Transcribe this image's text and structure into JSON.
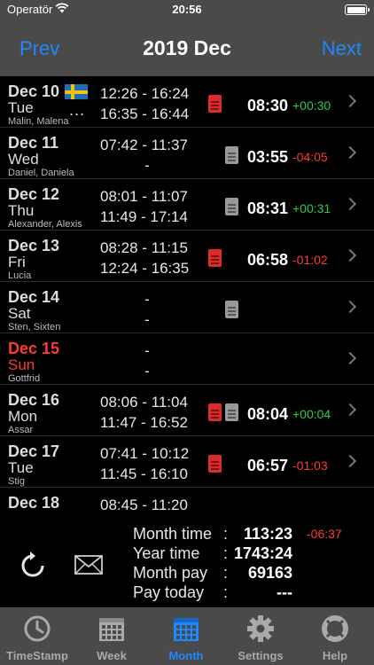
{
  "status": {
    "carrier": "Operatör",
    "time": "20:56"
  },
  "nav": {
    "prev": "Prev",
    "title": "2019 Dec",
    "next": "Next"
  },
  "days": [
    {
      "date": "Dec 10",
      "weekday": "Tue",
      "names": "Malin, Malena",
      "flag": "swedish-flag",
      "more": "...",
      "times": [
        "12:26 - 16:24",
        "16:35 - 16:44"
      ],
      "docs": [
        "red"
      ],
      "total": "08:30",
      "diff": "+00:30",
      "diff_sign": "pos"
    },
    {
      "date": "Dec 11",
      "weekday": "Wed",
      "names": "Daniel, Daniela",
      "times": [
        "07:42 - 11:37",
        "-"
      ],
      "docs": [
        "gray"
      ],
      "total": "03:55",
      "diff": "-04:05",
      "diff_sign": "neg"
    },
    {
      "date": "Dec 12",
      "weekday": "Thu",
      "names": "Alexander, Alexis",
      "times": [
        "08:01 - 11:07",
        "11:49 - 17:14"
      ],
      "docs": [
        "gray"
      ],
      "total": "08:31",
      "diff": "+00:31",
      "diff_sign": "pos"
    },
    {
      "date": "Dec 13",
      "weekday": "Fri",
      "names": "Lucia",
      "times": [
        "08:28 - 11:15",
        "12:24 - 16:35"
      ],
      "docs": [
        "red"
      ],
      "total": "06:58",
      "diff": "-01:02",
      "diff_sign": "neg"
    },
    {
      "date": "Dec 14",
      "weekday": "Sat",
      "names": "Sten, Sixten",
      "times": [
        "-",
        "-"
      ],
      "docs": [
        "gray"
      ],
      "total": "",
      "diff": "",
      "diff_sign": ""
    },
    {
      "date": "Dec 15",
      "weekday": "Sun",
      "names": "Gottfrid",
      "sunday": true,
      "times": [
        "-",
        "-"
      ],
      "docs": [],
      "total": "",
      "diff": "",
      "diff_sign": ""
    },
    {
      "date": "Dec 16",
      "weekday": "Mon",
      "names": "Assar",
      "times": [
        "08:06 - 11:04",
        "11:47 - 16:52"
      ],
      "docs": [
        "red",
        "gray"
      ],
      "total": "08:04",
      "diff": "+00:04",
      "diff_sign": "pos"
    },
    {
      "date": "Dec 17",
      "weekday": "Tue",
      "names": "Stig",
      "times": [
        "07:41 - 10:12",
        "11:45 - 16:10"
      ],
      "docs": [
        "red"
      ],
      "total": "06:57",
      "diff": "-01:03",
      "diff_sign": "neg"
    },
    {
      "date": "Dec 18",
      "weekday": "",
      "names": "",
      "times": [
        "08:45 - 11:20",
        ""
      ],
      "docs": [],
      "total": "",
      "diff": "",
      "diff_sign": ""
    }
  ],
  "summary": {
    "month_time_label": "Month time",
    "month_time_value": "113:23",
    "month_time_diff": "-06:37",
    "year_time_label": "Year time",
    "year_time_value": "1743:24",
    "month_pay_label": "Month pay",
    "month_pay_value": "69163",
    "pay_today_label": "Pay today",
    "pay_today_value": "---",
    "colon": ":"
  },
  "tabs": [
    {
      "label": "TimeStamp",
      "icon": "clock-icon"
    },
    {
      "label": "Week",
      "icon": "week-calendar-icon"
    },
    {
      "label": "Month",
      "icon": "month-calendar-icon",
      "active": true
    },
    {
      "label": "Settings",
      "icon": "gear-icon"
    },
    {
      "label": "Help",
      "icon": "lifebuoy-icon"
    }
  ],
  "colors": {
    "accent": "#1e88ff",
    "positive": "#2ec94c",
    "negative": "#ff3b30",
    "doc_red": "#dd2a2a",
    "doc_gray": "#9a9a9a",
    "bar_bg": "#4a4a4a"
  }
}
